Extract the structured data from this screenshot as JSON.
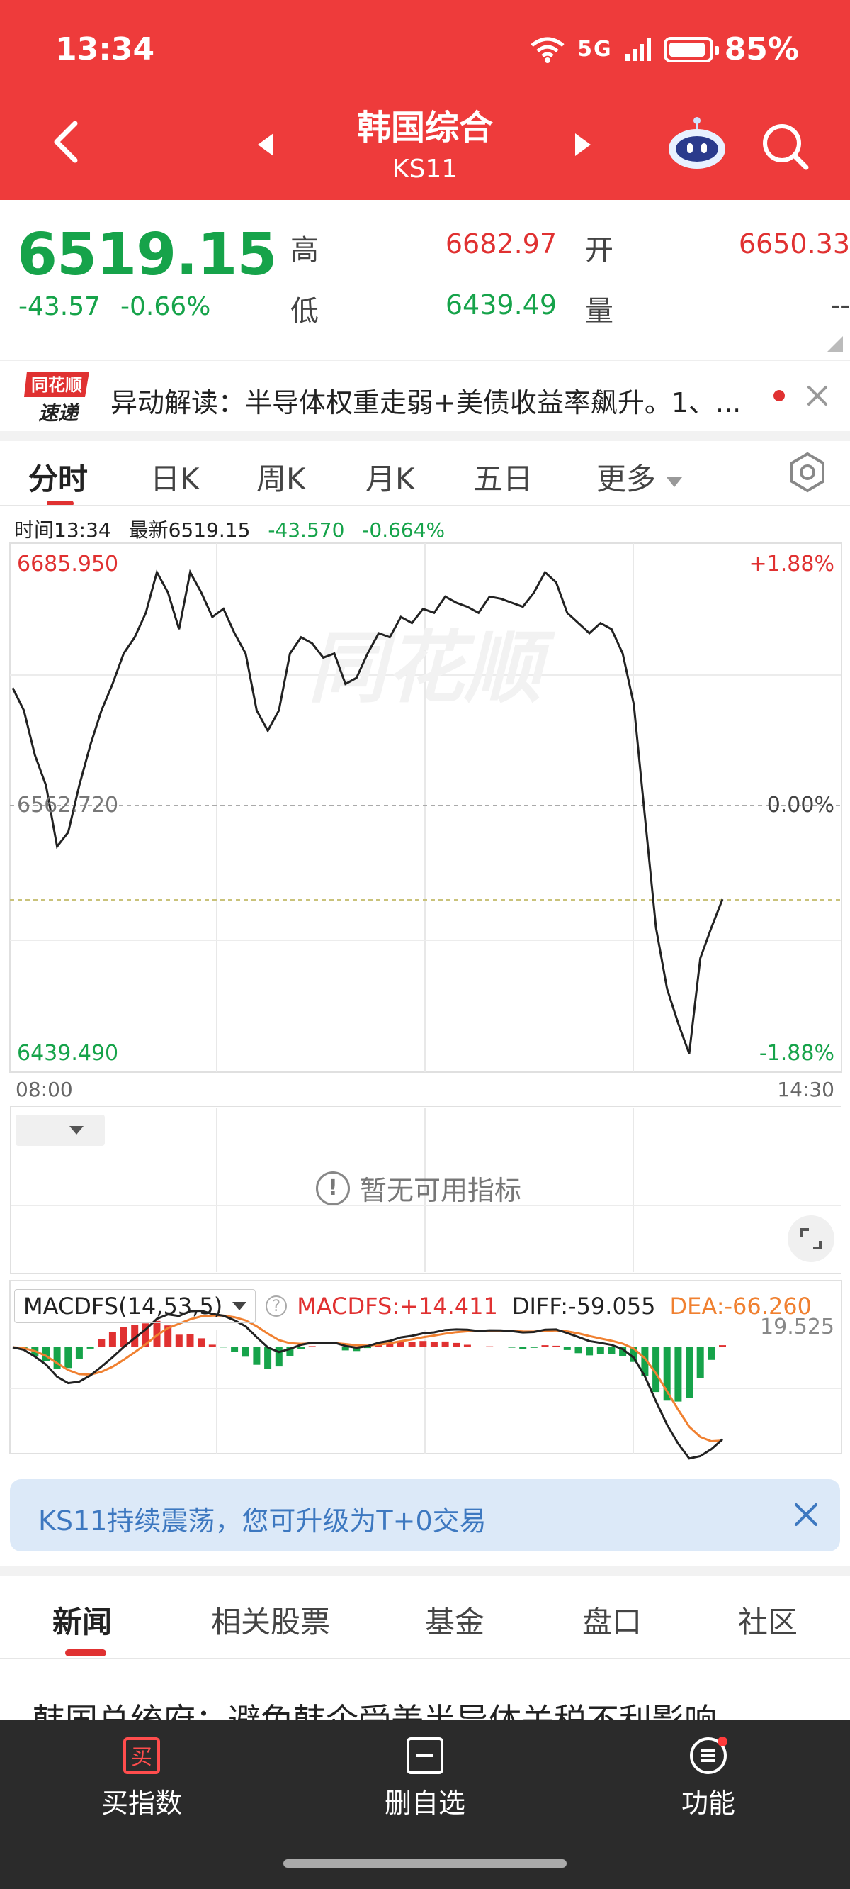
{
  "status_bar": {
    "time": "13:34",
    "signal": "5G",
    "battery": "85%"
  },
  "header": {
    "title": "韩国综合",
    "code": "KS11"
  },
  "quote": {
    "price": "6519.15",
    "change": "-43.57",
    "change_pct": "-0.66%",
    "high_label": "高",
    "high": "6682.97",
    "open_label": "开",
    "open": "6650.33",
    "low_label": "低",
    "low": "6439.49",
    "volume_label": "量",
    "volume": "--"
  },
  "ticker": {
    "logo_top": "同花顺",
    "logo_bottom": "速递",
    "text": "异动解读：半导体权重走弱+美债收益率飙升。1、..."
  },
  "period_tabs": [
    "分时",
    "日K",
    "周K",
    "月K",
    "五日",
    "更多"
  ],
  "info_line": {
    "time": "时间13:34",
    "latest": "最新6519.15",
    "change": "-43.570",
    "change_pct": "-0.664%"
  },
  "chart_axis": {
    "top_price": "6685.950",
    "top_pct": "+1.88%",
    "mid_price": "6562.720",
    "mid_pct": "0.00%",
    "bottom_price": "6439.490",
    "bottom_pct": "-1.88%",
    "start_time": "08:00",
    "end_time": "14:30",
    "watermark": "同花顺"
  },
  "chart_data": {
    "type": "line",
    "xlabel": "",
    "ylabel": "",
    "ylim": [
      6439.49,
      6685.95
    ],
    "x": [
      "08:00",
      "14:30"
    ],
    "series": [
      {
        "values": [
          6623,
          6612,
          6590,
          6575,
          6545,
          6552,
          6575,
          6595,
          6612,
          6625,
          6640,
          6648,
          6660,
          6680,
          6670,
          6652,
          6680,
          6670,
          6658,
          6662,
          6650,
          6640,
          6612,
          6602,
          6612,
          6640,
          6648,
          6645,
          6638,
          6640,
          6625,
          6628,
          6640,
          6650,
          6648,
          6658,
          6655,
          6662,
          6660,
          6668,
          6665,
          6663,
          6660,
          6668,
          6667,
          6665,
          6663,
          6670,
          6680,
          6675,
          6660,
          6655,
          6650,
          6655,
          6652,
          6640,
          6615,
          6560,
          6505,
          6475,
          6458,
          6443,
          6490,
          6505,
          6519
        ]
      }
    ],
    "baseline": 6562.72
  },
  "indicator_panel": {
    "empty_text": "暂无可用指标",
    "info_glyph": "!"
  },
  "macd": {
    "selector": "MACDFS(14,53,5)",
    "macdfs": "MACDFS:+14.411",
    "diff": "DIFF:-59.055",
    "dea": "DEA:-66.260",
    "axis_top": "19.525",
    "help_glyph": "?"
  },
  "promo": {
    "text": "KS11持续震荡，您可升级为T+0交易"
  },
  "news_tabs": [
    "新闻",
    "相关股票",
    "基金",
    "盘口",
    "社区"
  ],
  "headline": "韩国总统府：避免韩企受美半导体关税不利影响",
  "bottom_bar": [
    {
      "label": "买指数",
      "icon_glyph": "买"
    },
    {
      "label": "删自选"
    },
    {
      "label": "功能"
    }
  ],
  "colors": {
    "brand_red": "#ee3b3b",
    "up": "#e03131",
    "down": "#16a34a",
    "promo_text": "#3d78c0"
  }
}
